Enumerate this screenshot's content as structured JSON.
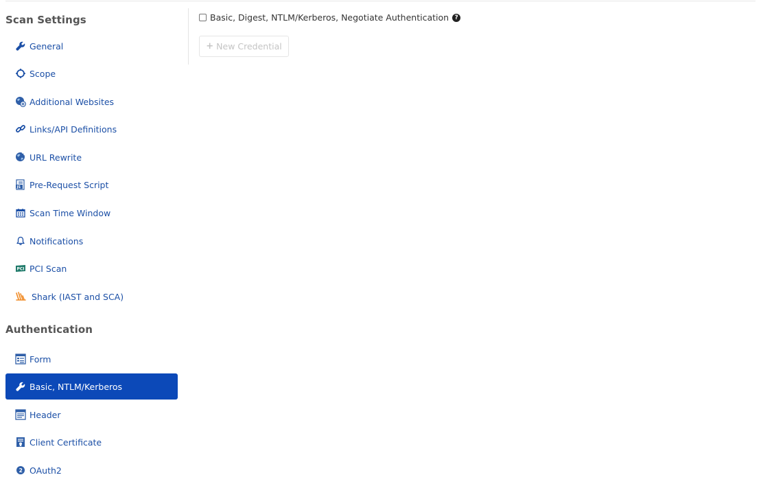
{
  "sections": {
    "scan_settings": "Scan Settings",
    "authentication": "Authentication"
  },
  "scan_items": {
    "general": "General",
    "scope": "Scope",
    "additional_websites": "Additional Websites",
    "links_api": "Links/API Definitions",
    "url_rewrite": "URL Rewrite",
    "pre_request": "Pre-Request Script",
    "scan_time_window": "Scan Time Window",
    "notifications": "Notifications",
    "pci_scan": "PCI Scan",
    "shark": "Shark (IAST and SCA)"
  },
  "auth_items": {
    "form": "Form",
    "basic": "Basic, NTLM/Kerberos",
    "header": "Header",
    "client_certificate": "Client Certificate",
    "oauth2": "OAuth2"
  },
  "active_item": "Basic, NTLM/Kerberos",
  "main": {
    "auth_checkbox_label": "Basic, Digest, NTLM/Kerberos, Negotiate Authentication",
    "auth_checkbox_checked": false,
    "new_credential_label": "New Credential",
    "new_credential_disabled": true
  },
  "colors": {
    "link": "#1b4fa6",
    "active_bg": "#0c49b8",
    "section_title": "#555555",
    "shark_icon": "#f08a24"
  }
}
